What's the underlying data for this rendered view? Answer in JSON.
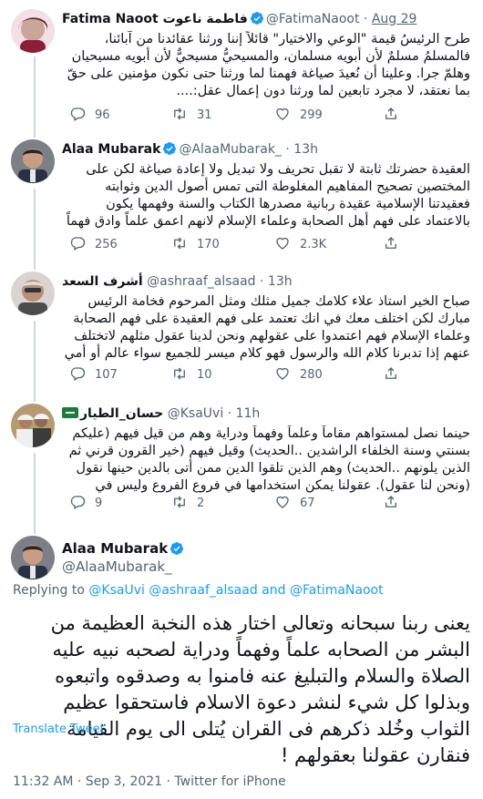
{
  "tweets": [
    {
      "display_name": "Fatima Naoot فاطمة ناعوت",
      "handle": "@FatimaNaoot",
      "time": "Aug 29",
      "verified": true,
      "text": "طرح الرئيسُ قيمة \"الوعي والاختيار\" قائلاً إننا ورثنا عقائدنا من آبائنا، فالمسلمُ مسلمٌ لأن أبويه مسلمان، والمسيحيُّ مسيحيٌّ لأن أبويه مسيحيان وهلمّ جرا. وعلينا أن نُعيدَ صياغة فهمنا لما ورثنا حتى نكون مؤمنين على حقّ بما نعتقد، لا مجرد تابعين لما ورثنا دون إعمال عقل:....",
      "replies": "96",
      "retweets": "31",
      "likes": "299"
    },
    {
      "display_name": "Alaa Mubarak",
      "handle": "@AlaaMubarak_",
      "time": "13h",
      "verified": true,
      "text": "العقيدة حضرتك ثابتة لا تقبل تحريف ولا تبديل ولا إعادة صياغة لكن على المختصين تصحيح المفاهيم المغلوطة التى تمس أصول الدين وثوابته فعقيدتنا الإسلامية عقيدة ربانية مصدرها الكتاب والسنة وفهمها يكون بالاعتماد على فهم أهل الصحابة وعلماء الإسلام لانهم اعمق علماً وادق فهماً لها.",
      "replies": "256",
      "retweets": "170",
      "likes": "2.3K"
    },
    {
      "display_name": "أشرف السعد",
      "handle": "@ashraaf_alsaad",
      "time": "13h",
      "verified": false,
      "text": "صباح الخير استاذ علاء كلامك جميل مثلك ومثل المرحوم فخامة الرئيس مبارك لكن اختلف معك في انك تعتمد على فهم العقيدة على فهم الصحابة وعلماء الإسلام فهم اعتمدوا على عقولهم ونحن لدينا عقول مثلهم لاتختلف عنهم إذا تدبرنا كلام الله والرسول فهو كلام ميسر للجميع سواء عالم أو أمي",
      "replies": "107",
      "retweets": "10",
      "likes": "280"
    },
    {
      "display_name": "حسان_الطيار",
      "handle": "@KsaUvi",
      "time": "11h",
      "verified": false,
      "text": "حينما نصل لمستواهم مقاماً وعلماً وفهماً ودراية وهم من قيل فيهم (عليكم بسنتي وسنة الخلفاء الراشدين ..الحديث) وقيل فيهم (خير القرون قرني ثم الذين يلونهم ..الحديث) وهم الذين تلقوا الدين ممن أتى بالدين حينها نقول (ونحن لنا عقول). عقولنا يمكن استخدامها في فروع الفروع وليس في الثوابت",
      "replies": "9",
      "retweets": "2",
      "likes": "67"
    }
  ],
  "main_tweet": {
    "display_name": "Alaa Mubarak",
    "handle": "@AlaaMubarak_",
    "verified": true,
    "replying_prefix": "Replying to",
    "replying_users": "@KsaUvi @ashraaf_alsaad",
    "replying_and": "and",
    "replying_last": "@FatimaNaoot",
    "text": "يعنى ربنا سبحانه وتعالى اختار هذه النخبة العظيمة من البشر من الصحابه علماً وفهماً ودراية لصحبه نبيه عليه الصلاة والسلام والتبليغ عنه فامنوا به وصدقوه واتبعوه وبذلوا كل شيء لنشر دعوة الاسلام فاستحقوا عظيم الثواب وخُلد ذكرهم فى القران يُتلى الى يوم القيامة فنقارن عقولنا بعقولهم !",
    "translate": "Translate Tweet",
    "timestamp": "11:32 AM · Sep 3, 2021 · Twitter for iPhone"
  },
  "colors": {
    "accent": "#1d9bf0",
    "muted": "#536471",
    "text": "#0f1419",
    "border": "#eff3f4",
    "flag_green": "#1e7a3a"
  },
  "icons": [
    "reply-icon",
    "retweet-icon",
    "like-icon",
    "share-icon",
    "verified-icon",
    "saudi-flag-icon"
  ]
}
